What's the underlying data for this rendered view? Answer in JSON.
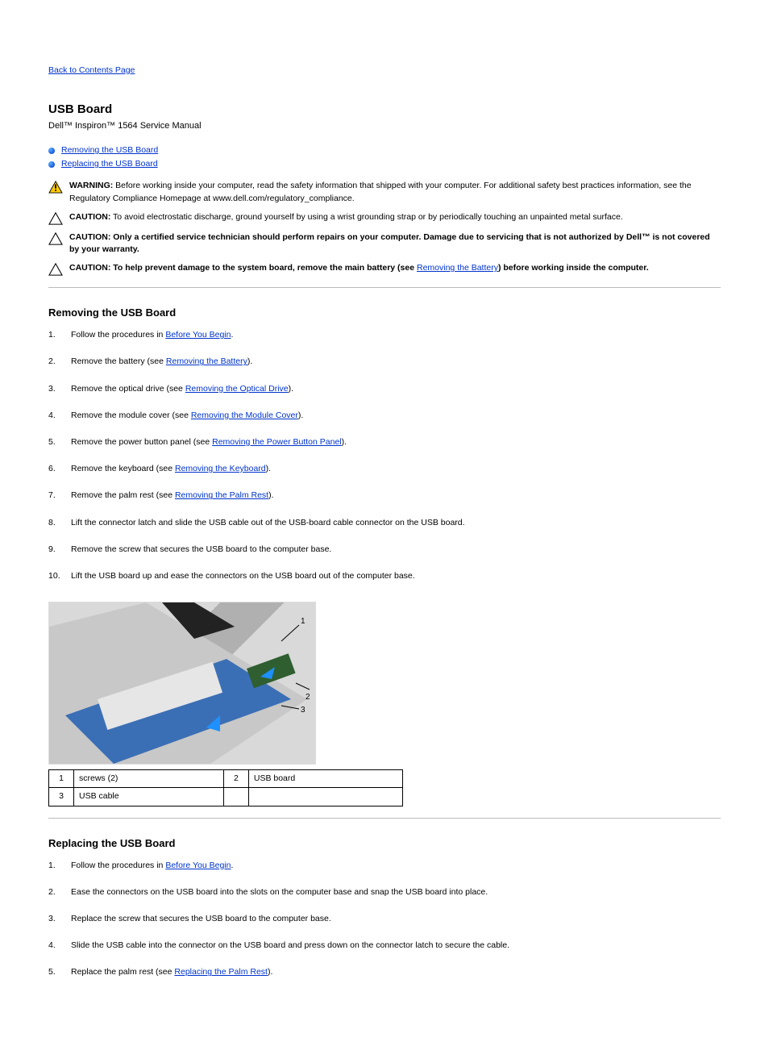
{
  "nav": {
    "back": "Back to Contents Page"
  },
  "title": "USB Board",
  "subtitle": "Dell™ Inspiron™ 1564 Service Manual",
  "toc": [
    {
      "label": "Removing the USB Board",
      "target": "removing"
    },
    {
      "label": "Replacing the USB Board",
      "target": "replacing"
    }
  ],
  "callouts": {
    "warning": {
      "label": "WARNING:",
      "text": " Before working inside your computer, read the safety information that shipped with your computer. For additional safety best practices information, see the Regulatory Compliance Homepage at www.dell.com/regulatory_compliance."
    },
    "caution1": {
      "label": "CAUTION:",
      "text": " To avoid electrostatic discharge, ground yourself by using a wrist grounding strap or by periodically touching an unpainted metal surface."
    },
    "caution2": {
      "label": "CAUTION:",
      "text_before": " Only a certified service technician should perform repairs on your computer. Damage due to servicing that is not authorized by Dell",
      "tm": "™",
      "text_after": " is not covered by your warranty."
    },
    "caution3": {
      "label": "CAUTION:",
      "text_before": " To help prevent damage to the system board, remove the main battery (see ",
      "link": "Removing the Battery",
      "text_after": ") before working inside the computer."
    }
  },
  "sections": {
    "removing": {
      "heading": "Removing the USB Board",
      "steps": [
        {
          "pre": "Follow the procedures in ",
          "link": "Before You Begin",
          "post": "."
        },
        {
          "pre": "Remove the battery (see ",
          "link": "Removing the Battery",
          "post": ")."
        },
        {
          "pre": "Remove the optical drive (see ",
          "link": "Removing the Optical Drive",
          "post": ")."
        },
        {
          "pre": "Remove the module cover (see ",
          "link": "Removing the Module Cover",
          "post": ")."
        },
        {
          "pre": "Remove the power button panel (see ",
          "link": "Removing the Power Button Panel",
          "post": ")."
        },
        {
          "pre": "Remove the keyboard (see ",
          "link": "Removing the Keyboard",
          "post": ")."
        },
        {
          "pre": "Remove the palm rest (see ",
          "link": "Removing the Palm Rest",
          "post": ")."
        },
        {
          "pre": "Lift the connector latch and slide the USB cable out of the USB-board cable connector on the USB board."
        },
        {
          "pre": "Remove the screw that secures the USB board to the computer base."
        },
        {
          "pre": "Lift the USB board up and ease the connectors on the USB board out of the computer base."
        }
      ],
      "labels": [
        [
          "1",
          "screws (2)",
          "2",
          "USB board"
        ],
        [
          "3",
          "USB cable",
          "",
          ""
        ]
      ]
    },
    "replacing": {
      "heading": "Replacing the USB Board",
      "steps": [
        {
          "pre": "Follow the procedures in ",
          "link": "Before You Begin",
          "post": "."
        },
        {
          "pre": "Ease the connectors on the USB board into the slots on the computer base and snap the USB board into place."
        },
        {
          "pre": "Replace the screw that secures the USB board to the computer base."
        },
        {
          "pre": "Slide the USB cable into the connector on the USB board and press down on the connector latch to secure the cable."
        },
        {
          "pre": "Replace the palm rest (see ",
          "link": "Replacing the Palm Rest",
          "post": ")."
        }
      ]
    }
  }
}
